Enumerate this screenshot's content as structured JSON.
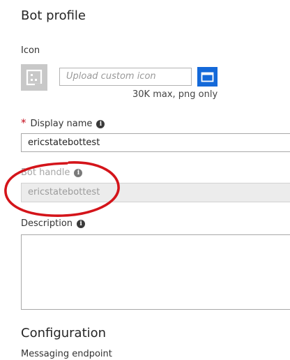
{
  "profile": {
    "title": "Bot profile",
    "icon_label": "Icon",
    "upload_placeholder": "Upload custom icon",
    "upload_note": "30K max, png only"
  },
  "display_name": {
    "required_mark": "*",
    "label": "Display name",
    "value": "ericstatebottest"
  },
  "bot_handle": {
    "label": "Bot handle",
    "value": "ericstatebottest"
  },
  "description": {
    "label": "Description",
    "value": ""
  },
  "configuration": {
    "title": "Configuration",
    "endpoint_label": "Messaging endpoint"
  },
  "colors": {
    "accent": "#1469d9",
    "required": "#c50f1f",
    "annotation": "#d4141a"
  },
  "icons": {
    "placeholder": "image-placeholder-icon",
    "browse": "folder-browse-icon",
    "info": "info-icon"
  }
}
